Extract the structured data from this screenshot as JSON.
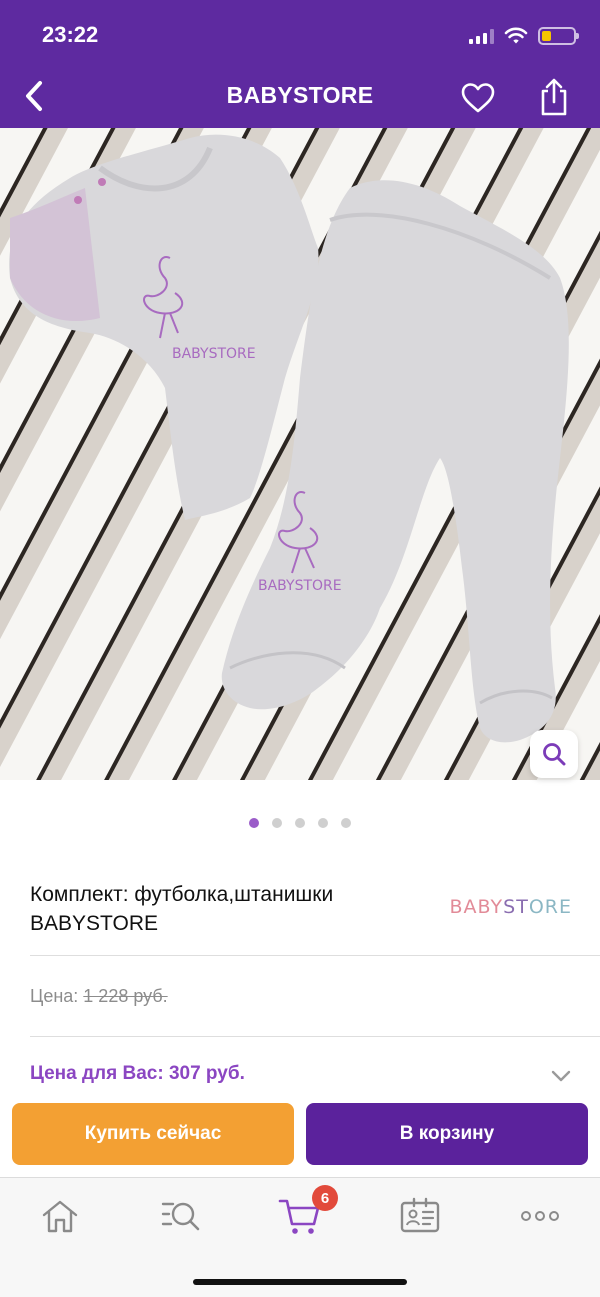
{
  "status_bar": {
    "time": "23:22"
  },
  "nav": {
    "title": "BABYSTORE",
    "icons": {
      "back": "chevron-left-icon",
      "favorite": "heart-icon",
      "share": "share-icon"
    }
  },
  "gallery": {
    "slide_count": 5,
    "active_slide": 1,
    "print_logo": "BABYSTORE"
  },
  "product": {
    "title": "Комплект: футболка,штанишки BABYSTORE",
    "brand_logo": {
      "part1": "BABY",
      "part2": "ST",
      "part3": "ORE"
    },
    "old_price_label": "Цена:",
    "old_price_value": "1 228 руб.",
    "your_price": "Цена для Вас: 307 руб."
  },
  "actions": {
    "buy_now": "Купить сейчас",
    "add_to_cart": "В корзину"
  },
  "tabbar": {
    "cart_badge": "6",
    "icons": [
      "home-icon",
      "search-catalog-icon",
      "cart-icon",
      "profile-card-icon",
      "more-icon"
    ]
  },
  "colors": {
    "brand_purple": "#5e2aa0",
    "accent_purple": "#8b46c2",
    "buy_orange": "#f3a033",
    "badge_red": "#e24a3b"
  }
}
